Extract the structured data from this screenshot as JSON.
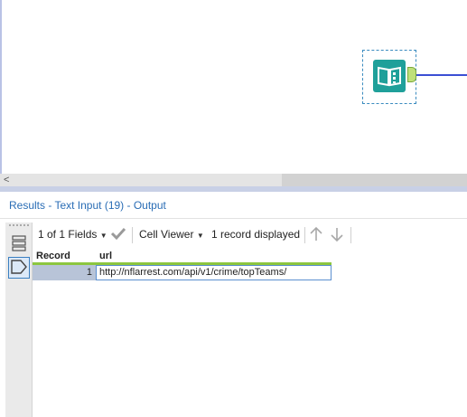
{
  "canvas": {
    "tool_name": "Text Input",
    "tool_color": "#1fa09a",
    "connector_color": "#3b4fd4",
    "anchor_color": "#bfe07a"
  },
  "scrollbar": {
    "left_arrow": "<"
  },
  "results": {
    "title": "Results - Text Input (19) - Output",
    "toolbar": {
      "fields_label": "1 of 1 Fields",
      "cell_viewer_label": "Cell Viewer",
      "records_label": "1 record displayed"
    },
    "grid": {
      "columns": [
        "Record",
        "url"
      ],
      "rows": [
        {
          "record": "1",
          "url": "http://nflarrest.com/api/v1/crime/topTeams/"
        }
      ]
    },
    "rail": {
      "items": [
        "table-view-icon",
        "metadata-tag-icon"
      ]
    }
  }
}
